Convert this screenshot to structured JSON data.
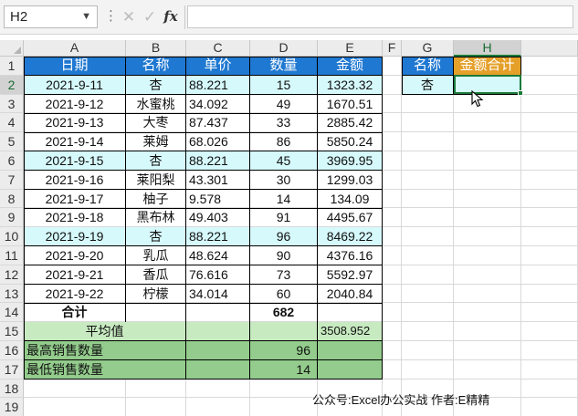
{
  "formula_bar": {
    "name_box": "H2",
    "formula": "",
    "cancel_glyph": "✕",
    "enter_glyph": "✓",
    "fx_label": "fx"
  },
  "columns": [
    "A",
    "B",
    "C",
    "D",
    "E",
    "F",
    "G",
    "H"
  ],
  "rows": [
    "1",
    "2",
    "3",
    "4",
    "5",
    "6",
    "7",
    "8",
    "9",
    "10",
    "11",
    "12",
    "13",
    "14",
    "15",
    "16",
    "17",
    "18",
    "19"
  ],
  "table": {
    "headers": [
      "日期",
      "名称",
      "单价",
      "数量",
      "金额"
    ],
    "rows": [
      {
        "date": "2021-9-11",
        "name": "杏",
        "price": "88.221",
        "qty": "15",
        "amount": "1323.32"
      },
      {
        "date": "2021-9-12",
        "name": "水蜜桃",
        "price": "34.092",
        "qty": "49",
        "amount": "1670.51"
      },
      {
        "date": "2021-9-13",
        "name": "大枣",
        "price": "87.437",
        "qty": "33",
        "amount": "2885.42"
      },
      {
        "date": "2021-9-14",
        "name": "莱姆",
        "price": "68.026",
        "qty": "86",
        "amount": "5850.24"
      },
      {
        "date": "2021-9-15",
        "name": "杏",
        "price": "88.221",
        "qty": "45",
        "amount": "3969.95"
      },
      {
        "date": "2021-9-16",
        "name": "莱阳梨",
        "price": "43.301",
        "qty": "30",
        "amount": "1299.03"
      },
      {
        "date": "2021-9-17",
        "name": "柚子",
        "price": "9.578",
        "qty": "14",
        "amount": "134.09"
      },
      {
        "date": "2021-9-18",
        "name": "黑布林",
        "price": "49.403",
        "qty": "91",
        "amount": "4495.67"
      },
      {
        "date": "2021-9-19",
        "name": "杏",
        "price": "88.221",
        "qty": "96",
        "amount": "8469.22"
      },
      {
        "date": "2021-9-20",
        "name": "乳瓜",
        "price": "48.624",
        "qty": "90",
        "amount": "4376.16"
      },
      {
        "date": "2021-9-21",
        "name": "香瓜",
        "price": "76.616",
        "qty": "73",
        "amount": "5592.97"
      },
      {
        "date": "2021-9-22",
        "name": "柠檬",
        "price": "34.014",
        "qty": "60",
        "amount": "2040.84"
      }
    ],
    "total_label": "合计",
    "total_qty": "682",
    "avg_label": "平均值",
    "avg_amount": "3508.952",
    "max_label": "最高销售数量",
    "max_qty": "96",
    "min_label": "最低销售数量",
    "min_qty": "14"
  },
  "lookup": {
    "header_name": "名称",
    "header_sum": "金额合计",
    "name_value": "杏",
    "sum_value": ""
  },
  "footer_note": "公众号:Excel办公实战  作者:E精精",
  "colors": {
    "header_blue": "#1f78d1",
    "highlight_cyan": "#d6f9fb",
    "light_green": "#c7eac0",
    "dark_green": "#93cc8c",
    "orange": "#e5a02a",
    "selection_green": "#1a7a3a"
  }
}
